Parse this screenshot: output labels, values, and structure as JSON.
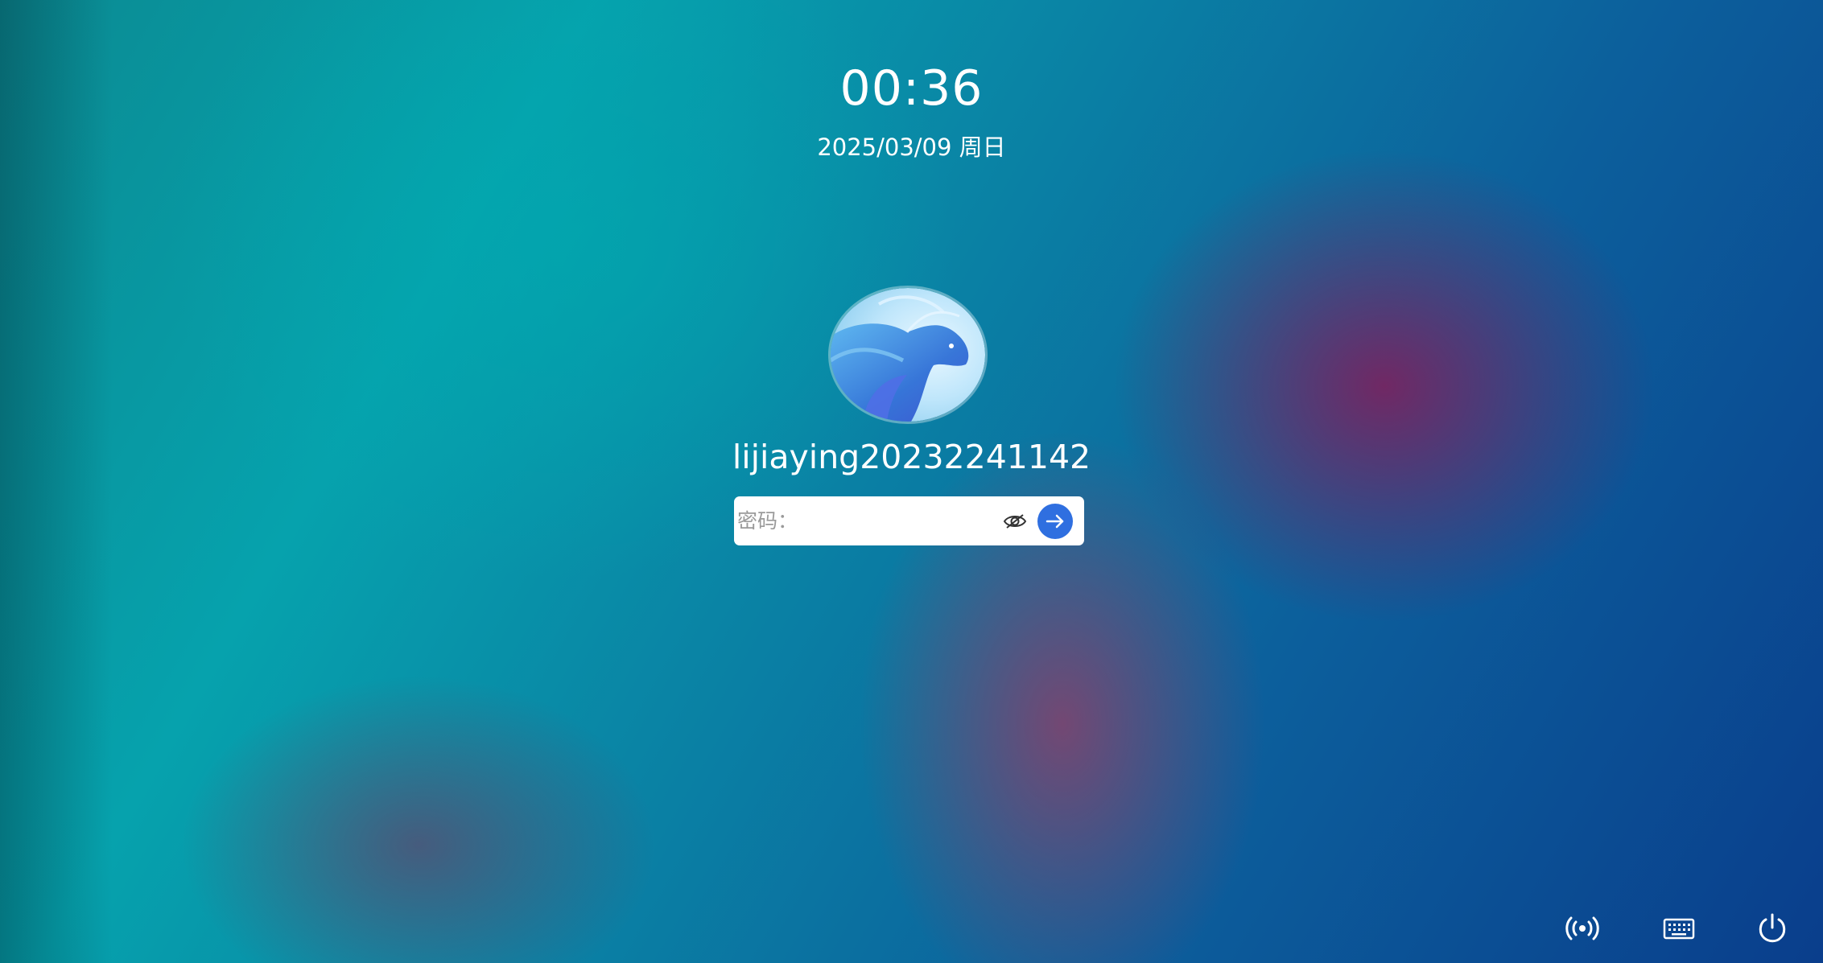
{
  "lockscreen": {
    "time": "00:36",
    "date": "2025/03/09 周日",
    "username": "lijiaying20232241142",
    "password_placeholder": "密码："
  },
  "icons": {
    "avatar": "dragon-avatar",
    "password_visibility": "eye-slash-icon",
    "submit": "arrow-right-icon",
    "network": "network-wireless-icon",
    "keyboard": "keyboard-icon",
    "power": "power-icon"
  },
  "colors": {
    "accent": "#2f6fe0",
    "text": "#ffffff",
    "input_background": "#ffffff"
  }
}
